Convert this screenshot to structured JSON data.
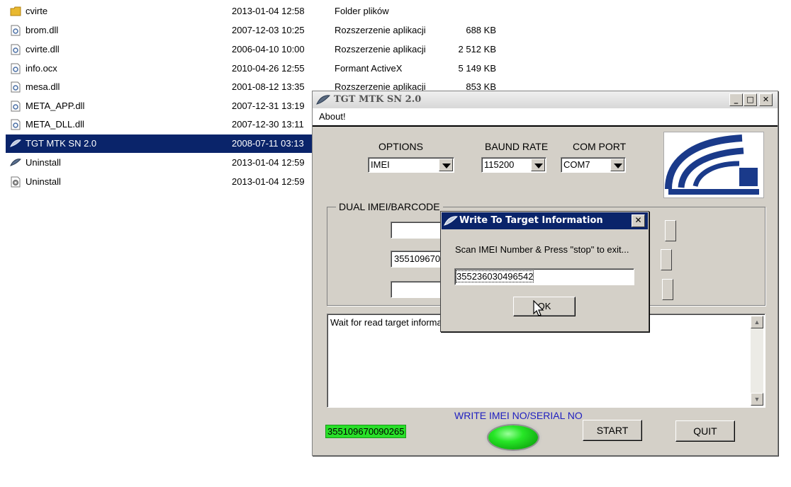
{
  "explorer": {
    "files": [
      {
        "name": "cvirte",
        "date": "2013-01-04 12:58",
        "type": "Folder plików",
        "size": "",
        "icon": "folder-icon"
      },
      {
        "name": "brom.dll",
        "date": "2007-12-03 10:25",
        "type": "Rozszerzenie aplikacji",
        "size": "688 KB",
        "icon": "dll-file-icon"
      },
      {
        "name": "cvirte.dll",
        "date": "2006-04-10 10:00",
        "type": "Rozszerzenie aplikacji",
        "size": "2 512 KB",
        "icon": "dll-file-icon"
      },
      {
        "name": "info.ocx",
        "date": "2010-04-26 12:55",
        "type": "Formant ActiveX",
        "size": "5 149 KB",
        "icon": "dll-file-icon"
      },
      {
        "name": "mesa.dll",
        "date": "2001-08-12 13:35",
        "type": "Rozszerzenie aplikacji",
        "size": "853 KB",
        "icon": "dll-file-icon"
      },
      {
        "name": "META_APP.dll",
        "date": "2007-12-31 13:19",
        "type": "",
        "size": "",
        "icon": "dll-file-icon"
      },
      {
        "name": "META_DLL.dll",
        "date": "2007-12-30 13:11",
        "type": "",
        "size": "",
        "icon": "dll-file-icon"
      },
      {
        "name": "TGT MTK SN 2.0",
        "date": "2008-07-11 03:13",
        "type": "",
        "size": "",
        "icon": "app-feather-icon"
      },
      {
        "name": "Uninstall",
        "date": "2013-01-04 12:59",
        "type": "",
        "size": "",
        "icon": "uninstall-feather-icon"
      },
      {
        "name": "Uninstall",
        "date": "2013-01-04 12:59",
        "type": "",
        "size": "",
        "icon": "gear-file-icon"
      }
    ],
    "selected_index": 7
  },
  "app": {
    "title": "TGT MTK SN 2.0",
    "menu": {
      "about": "About!"
    },
    "window_buttons": {
      "minimize": "_",
      "maximize": "□",
      "close": "✕"
    },
    "options": {
      "label": "OPTIONS",
      "value": "IMEI"
    },
    "baud": {
      "label": "BAUND RATE",
      "value": "115200"
    },
    "com": {
      "label": "COM PORT",
      "value": "COM7"
    },
    "group": {
      "title": "DUAL IMEI/BARCODE",
      "field1": "",
      "field2": "355109670",
      "field3": ""
    },
    "log": {
      "text": "Wait for read target informa"
    },
    "status_label": "WRITE IMEI NO/SERIAL NO",
    "imei_display": "355109670090265",
    "start_label": "START",
    "quit_label": "QUIT",
    "led_color": "#22dd22"
  },
  "dialog": {
    "title": "Write To Target Information",
    "close": "✕",
    "message": "Scan IMEI Number & Press \"stop\" to exit...",
    "input_value": "355236030496542",
    "ok_label": "OK"
  }
}
